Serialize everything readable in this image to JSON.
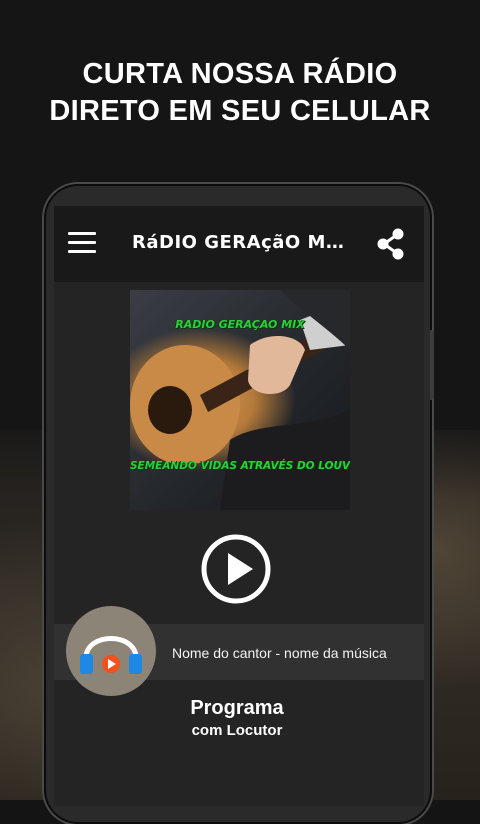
{
  "promo": {
    "headline_line1": "CURTA NOSSA RÁDIO",
    "headline_line2": "DIRETO EM SEU CELULAR"
  },
  "app": {
    "title": "RáDIO GERAçãO MIX",
    "menu_icon": "hamburger-menu-icon",
    "share_icon": "share-icon"
  },
  "album": {
    "top_text": "RADIO GERAÇAO MIX",
    "bottom_text": "SEMEANDO VIDAS ATRAVÉS DO LOUVOR"
  },
  "player": {
    "play_icon": "play-icon",
    "track": "Nome do cantor - nome da música",
    "logo_icon": "headphones-icon"
  },
  "program": {
    "title": "Programa",
    "subtitle": "com Locutor"
  },
  "colors": {
    "background": "#141414",
    "appbar": "#191919",
    "album_text": "#2ecc40",
    "headphone_blue": "#1e88e5",
    "play_orange": "#f4511e"
  }
}
